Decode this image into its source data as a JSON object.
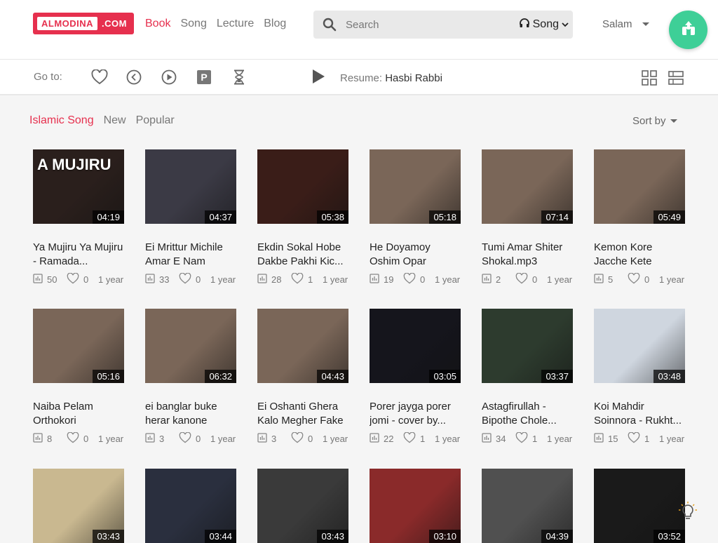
{
  "header": {
    "logo_main": "ALMODINA",
    "logo_tld": ".COM",
    "nav": [
      {
        "label": "Book",
        "active": true
      },
      {
        "label": "Song",
        "active": false
      },
      {
        "label": "Lecture",
        "active": false
      },
      {
        "label": "Blog",
        "active": false
      }
    ],
    "search_placeholder": "Search",
    "search_type": "Song",
    "user_label": "Salam"
  },
  "goto": {
    "label": "Go to:",
    "icons": [
      "heart-icon",
      "history-back-icon",
      "play-circle-icon",
      "parking-p-icon",
      "hourglass-icon"
    ],
    "resume_label": "Resume:",
    "resume_title": "Hasbi Rabbi"
  },
  "filters": [
    {
      "label": "Islamic Song",
      "active": true
    },
    {
      "label": "New",
      "active": false
    },
    {
      "label": "Popular",
      "active": false
    }
  ],
  "sort_label": "Sort by",
  "colors": {
    "accent": "#e6304e",
    "fab": "#3ecf97"
  },
  "cards": [
    {
      "title": "Ya Mujiru Ya Mujiru - Ramada...",
      "duration": "04:19",
      "plays": "50",
      "likes": "0",
      "age": "1 year",
      "thumb_text": "A MUJIRU",
      "bg": "#2a1f1c"
    },
    {
      "title": "Ei Mrittur Michile Amar E Nam",
      "duration": "04:37",
      "plays": "33",
      "likes": "0",
      "age": "1 year",
      "thumb_text": "",
      "bg": "#3b3a45"
    },
    {
      "title": "Ekdin Sokal Hobe Dakbe Pakhi Kic...",
      "duration": "05:38",
      "plays": "28",
      "likes": "1",
      "age": "1 year",
      "thumb_text": "",
      "bg": "#3a1d18"
    },
    {
      "title": "He Doyamoy Oshim Opar",
      "duration": "05:18",
      "plays": "19",
      "likes": "0",
      "age": "1 year",
      "thumb_text": "",
      "bg": "#7a6658"
    },
    {
      "title": "Tumi Amar Shiter Shokal.mp3",
      "duration": "07:14",
      "plays": "2",
      "likes": "0",
      "age": "1 year",
      "thumb_text": "",
      "bg": "#7a6658"
    },
    {
      "title": "Kemon Kore Jacche Kete",
      "duration": "05:49",
      "plays": "5",
      "likes": "0",
      "age": "1 year",
      "thumb_text": "",
      "bg": "#7a6658"
    },
    {
      "title": "Naiba Pelam Orthokori",
      "duration": "05:16",
      "plays": "8",
      "likes": "0",
      "age": "1 year",
      "thumb_text": "",
      "bg": "#7a6658"
    },
    {
      "title": "ei banglar buke herar kanone",
      "duration": "06:32",
      "plays": "3",
      "likes": "0",
      "age": "1 year",
      "thumb_text": "",
      "bg": "#7a6658"
    },
    {
      "title": "Ei Oshanti Ghera Kalo Megher Fake",
      "duration": "04:43",
      "plays": "3",
      "likes": "0",
      "age": "1 year",
      "thumb_text": "",
      "bg": "#7a6658"
    },
    {
      "title": "Porer jayga porer jomi - cover by...",
      "duration": "03:05",
      "plays": "22",
      "likes": "1",
      "age": "1 year",
      "thumb_text": "",
      "bg": "#15151c"
    },
    {
      "title": "Astagfirullah - Bipothe Chole...",
      "duration": "03:37",
      "plays": "34",
      "likes": "1",
      "age": "1 year",
      "thumb_text": "",
      "bg": "#2d3b2e"
    },
    {
      "title": "Koi Mahdir Soinnora - Rukht...",
      "duration": "03:48",
      "plays": "15",
      "likes": "1",
      "age": "1 year",
      "thumb_text": "",
      "bg": "#cfd6df"
    },
    {
      "title": "",
      "duration": "03:43",
      "plays": "",
      "likes": "",
      "age": "",
      "thumb_text": "",
      "bg": "#c9b890"
    },
    {
      "title": "",
      "duration": "03:44",
      "plays": "",
      "likes": "",
      "age": "",
      "thumb_text": "",
      "bg": "#2a2f3e"
    },
    {
      "title": "",
      "duration": "03:43",
      "plays": "",
      "likes": "",
      "age": "",
      "thumb_text": "",
      "bg": "#3a3a3a"
    },
    {
      "title": "",
      "duration": "03:10",
      "plays": "",
      "likes": "",
      "age": "",
      "thumb_text": "",
      "bg": "#8a2a2a"
    },
    {
      "title": "",
      "duration": "04:39",
      "plays": "",
      "likes": "",
      "age": "",
      "thumb_text": "",
      "bg": "#505050"
    },
    {
      "title": "",
      "duration": "03:52",
      "plays": "",
      "likes": "",
      "age": "",
      "thumb_text": "",
      "bg": "#1a1a1a"
    }
  ]
}
